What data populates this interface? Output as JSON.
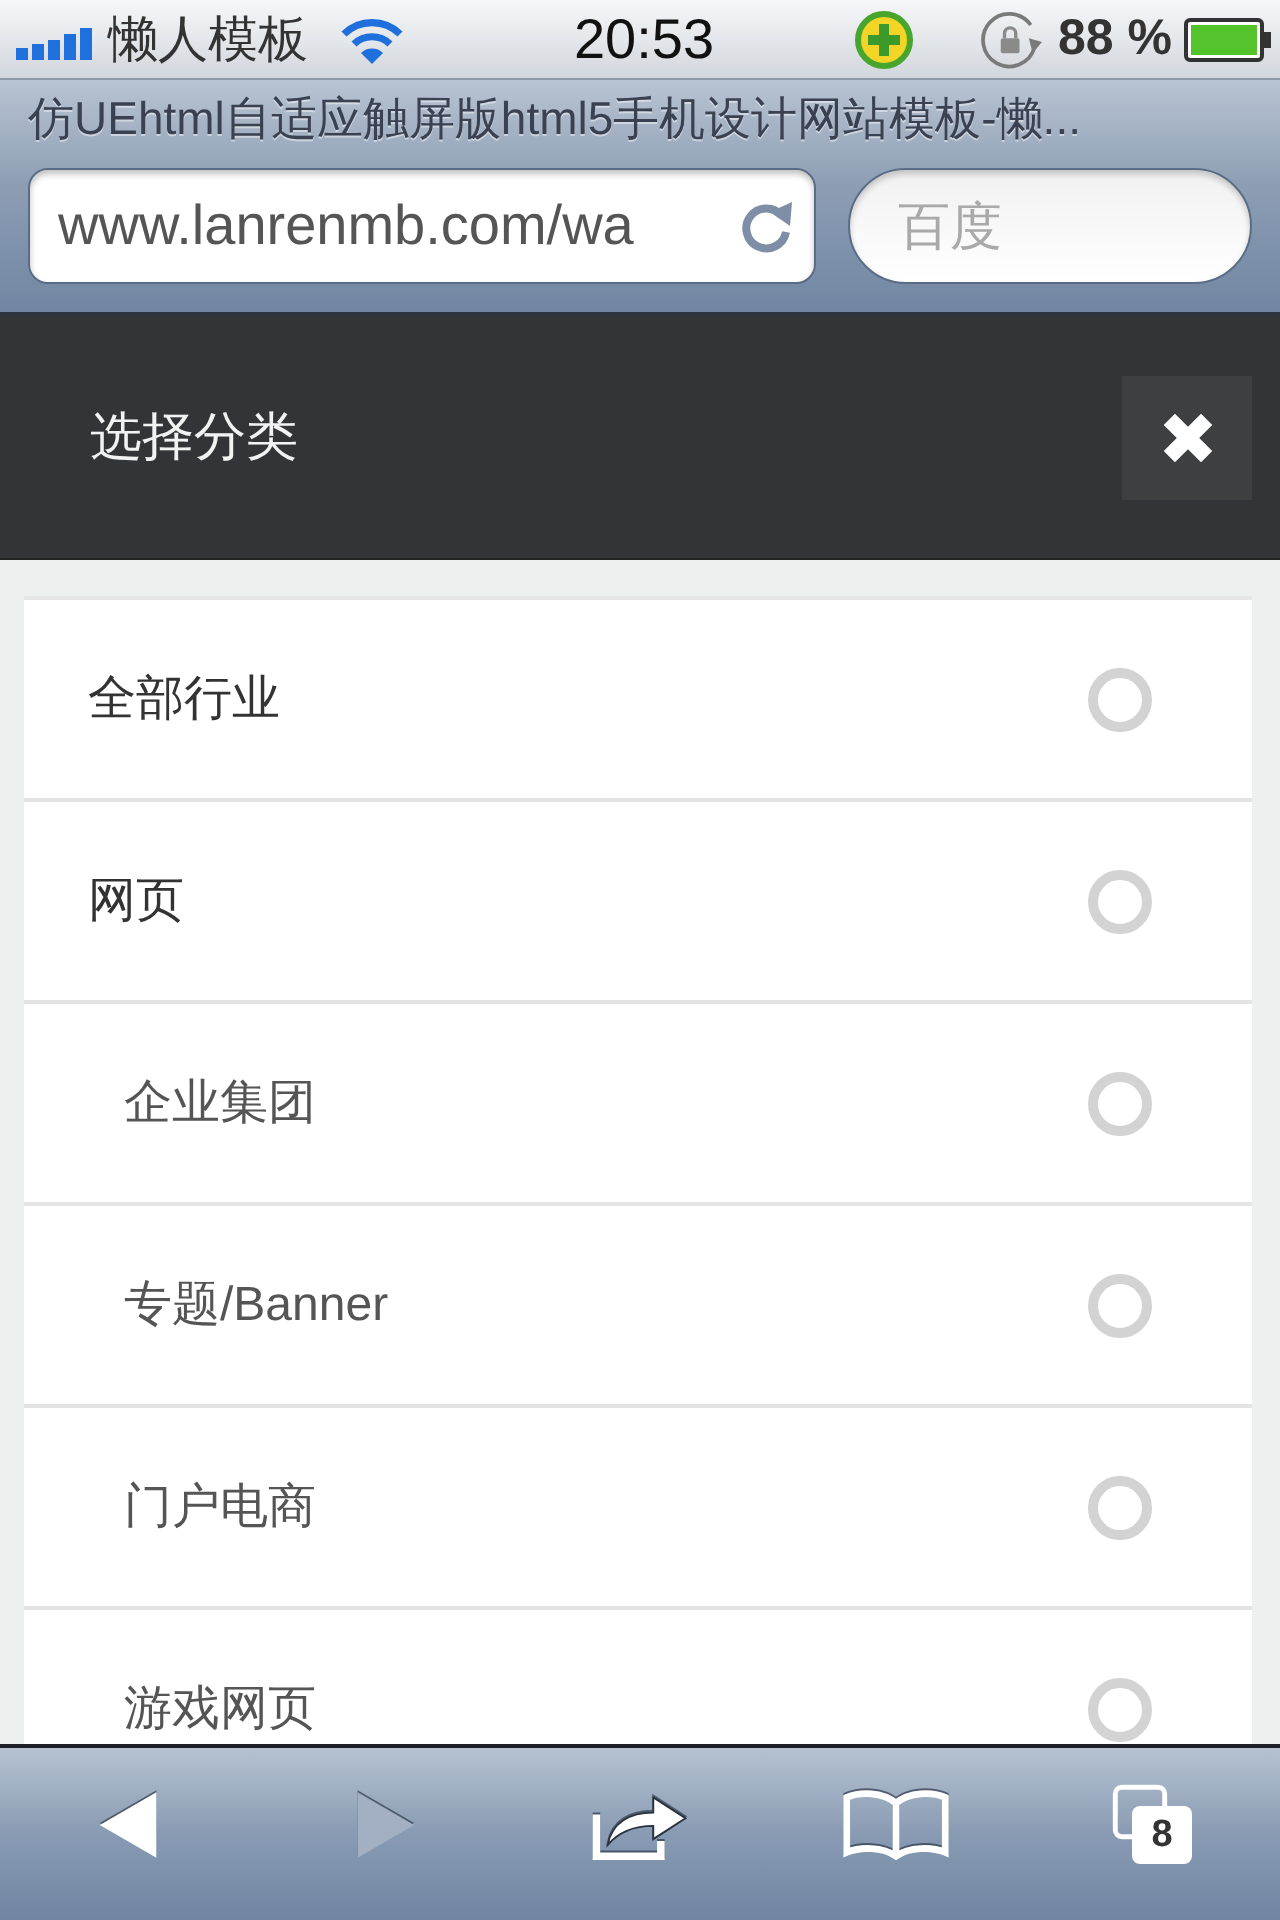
{
  "status_bar": {
    "carrier": "懒人模板",
    "time": "20:53",
    "battery_text": "88 %"
  },
  "browser": {
    "page_title": "仿UEhtml自适应触屏版html5手机设计网站模板-懒...",
    "address": {
      "value": "www.lanrenmb.com/wa"
    },
    "search": {
      "placeholder": "百度"
    }
  },
  "panel": {
    "title": "选择分类"
  },
  "categories": [
    {
      "label": "全部行业",
      "selected": false
    },
    {
      "label": "网页",
      "selected": false,
      "children": [
        {
          "label": "企业集团",
          "selected": false
        },
        {
          "label": "专题/Banner",
          "selected": false
        },
        {
          "label": "门户电商",
          "selected": false
        },
        {
          "label": "游戏网页",
          "selected": false
        }
      ]
    }
  ],
  "toolbar": {
    "back": {
      "disabled": false
    },
    "forward": {
      "disabled": true
    },
    "tab_count": "8"
  }
}
